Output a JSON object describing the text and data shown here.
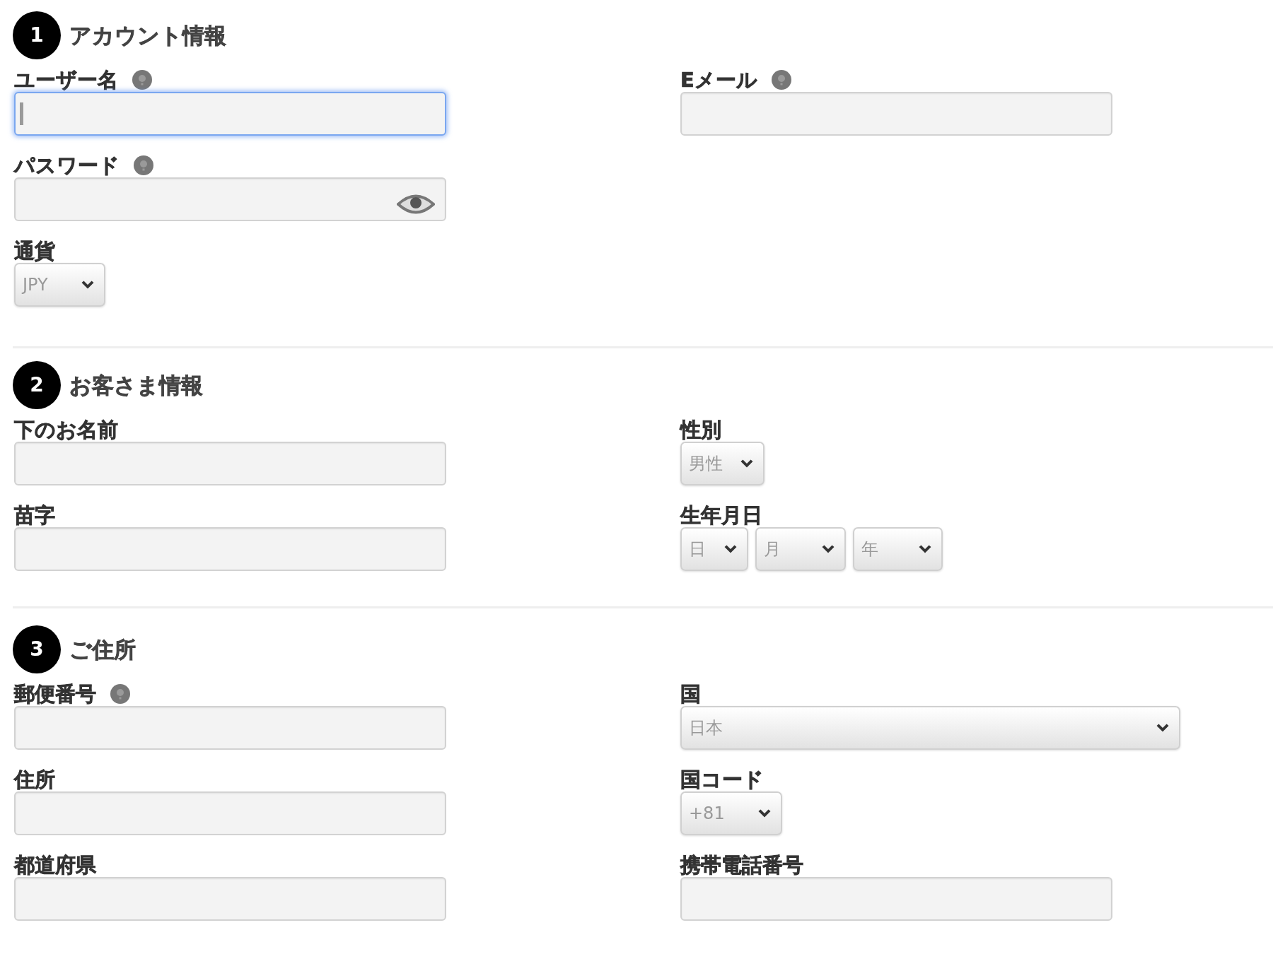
{
  "sections": [
    {
      "number": "1",
      "title": "アカウント情報",
      "columns": [
        [
          {
            "kind": "text",
            "label": "ユーザー名",
            "help": true,
            "focused": true
          },
          {
            "kind": "password",
            "label": "パスワード",
            "help": true,
            "focused": false
          },
          {
            "kind": "select",
            "label": "通貨",
            "help": false,
            "focused": false,
            "selects": [
              {
                "value": "JPY"
              }
            ]
          }
        ],
        [
          {
            "kind": "text",
            "label": "Eメール",
            "help": true,
            "focused": false
          }
        ]
      ]
    },
    {
      "number": "2",
      "title": "お客さま情報",
      "columns": [
        [
          {
            "kind": "text",
            "label": "下のお名前",
            "help": false,
            "focused": false
          },
          {
            "kind": "text",
            "label": "苗字",
            "help": false,
            "focused": false
          }
        ],
        [
          {
            "kind": "select",
            "label": "性別",
            "help": false,
            "focused": false,
            "selects": [
              {
                "value": "男性"
              }
            ]
          },
          {
            "kind": "select",
            "label": "生年月日",
            "help": false,
            "focused": false,
            "selects": [
              {
                "value": "日"
              },
              {
                "value": "月"
              },
              {
                "value": "年"
              }
            ]
          }
        ]
      ]
    },
    {
      "number": "3",
      "title": "ご住所",
      "columns": [
        [
          {
            "kind": "text",
            "label": "郵便番号",
            "help": true,
            "focused": false
          },
          {
            "kind": "text",
            "label": "住所",
            "help": false,
            "focused": false
          },
          {
            "kind": "text",
            "label": "都道府県",
            "help": false,
            "focused": false
          }
        ],
        [
          {
            "kind": "select",
            "label": "国",
            "help": false,
            "focused": false,
            "selects": [
              {
                "value": "日本"
              }
            ]
          },
          {
            "kind": "select",
            "label": "国コード",
            "help": false,
            "focused": false,
            "selects": [
              {
                "value": "+81"
              }
            ]
          },
          {
            "kind": "text",
            "label": "携帯電話番号",
            "help": false,
            "focused": false
          }
        ]
      ]
    }
  ]
}
